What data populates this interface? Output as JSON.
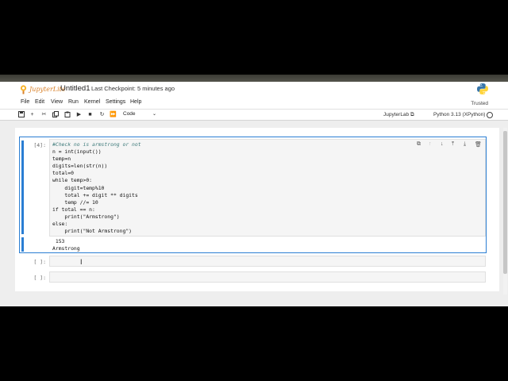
{
  "title": {
    "app_name": "JupyterLite",
    "notebook_name": "Untitled1",
    "checkpoint": "Last Checkpoint: 5 minutes ago"
  },
  "menu": [
    "File",
    "Edit",
    "View",
    "Run",
    "Kernel",
    "Settings",
    "Help"
  ],
  "trusted": "Trusted",
  "toolbar": {
    "cell_type": "Code",
    "jupyterlab_link": "JupyterLab",
    "kernel_name": "Python 3.13 (XPython)"
  },
  "cells": [
    {
      "prompt": "[4]:",
      "code_lines": [
        "#Check no is armstrong or not",
        "n = int(input())",
        "temp=n",
        "digits=len(str(n))",
        "total=0",
        "while temp>0:",
        "    digit=temp%10",
        "    total += digit ** digits",
        "    temp //= 10",
        "if total == n:",
        "    print(\"Armstrong\")",
        "else:",
        "    print(\"Not Armstrong\")"
      ],
      "output": [
        "153",
        "Armstrong"
      ]
    },
    {
      "prompt": "[ ]:"
    },
    {
      "prompt": "[ ]:"
    }
  ],
  "colors": {
    "accent": "#2a7ed3",
    "logo_orange": "#d9822b"
  }
}
